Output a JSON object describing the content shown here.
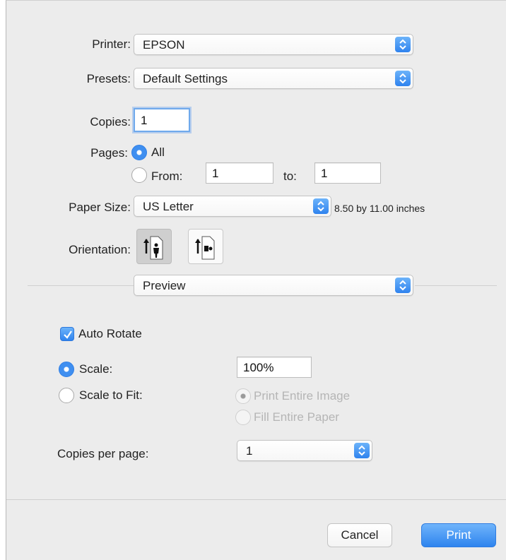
{
  "printer": {
    "label": "Printer:",
    "value": "EPSON"
  },
  "presets": {
    "label": "Presets:",
    "value": "Default Settings"
  },
  "copies": {
    "label": "Copies:",
    "value": "1"
  },
  "pages": {
    "label": "Pages:",
    "all_label": "All",
    "from_label": "From:",
    "from_value": "1",
    "to_label": "to:",
    "to_value": "1",
    "selected": "All"
  },
  "paper_size": {
    "label": "Paper Size:",
    "value": "US Letter",
    "dimensions": "8.50 by 11.00 inches"
  },
  "orientation": {
    "label": "Orientation:",
    "selected": "portrait",
    "options": [
      "portrait-icon",
      "landscape-icon"
    ]
  },
  "section_menu": {
    "value": "Preview"
  },
  "auto_rotate": {
    "label": "Auto Rotate",
    "checked": true
  },
  "scale": {
    "label": "Scale:",
    "value": "100%",
    "selected": true
  },
  "scale_to_fit": {
    "label": "Scale to Fit:",
    "print_entire_image": "Print Entire Image",
    "fill_entire_paper": "Fill Entire Paper"
  },
  "copies_per_page": {
    "label": "Copies per page:",
    "value": "1"
  },
  "buttons": {
    "cancel": "Cancel",
    "print": "Print"
  },
  "colors": {
    "accent": "#2f83ee",
    "background": "#ececec"
  }
}
